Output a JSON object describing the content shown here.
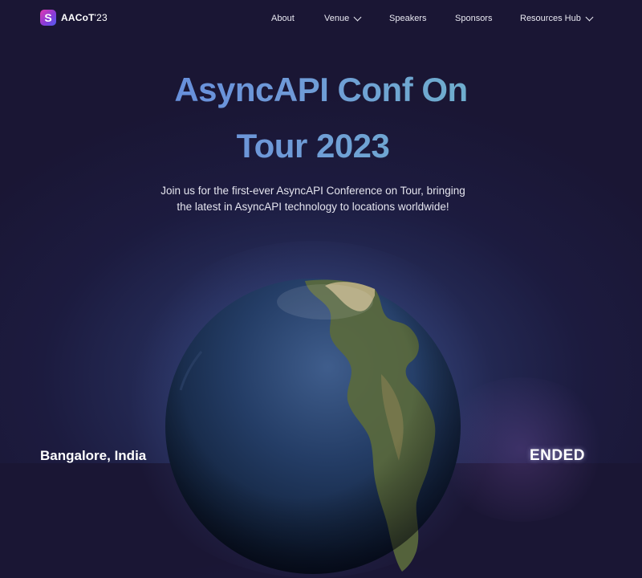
{
  "nav": {
    "logo_letter": "S",
    "logo_text": "AACoT",
    "logo_year": "'23",
    "items": [
      {
        "label": "About"
      },
      {
        "label": "Venue"
      },
      {
        "label": "Speakers"
      },
      {
        "label": "Sponsors"
      },
      {
        "label": "Resources Hub"
      }
    ]
  },
  "hero": {
    "title_line1": "AsyncAPI Conf On",
    "title_line2": "Tour 2023",
    "subtitle": "Join us for the first-ever AsyncAPI Conference on Tour, bringing the latest in AsyncAPI technology to locations worldwide!"
  },
  "event": {
    "location": "Bangalore, India",
    "status": "ENDED"
  },
  "colors": {
    "background": "#1c1b3f",
    "title_gradient_start": "#5b7fe0",
    "title_gradient_end": "#6fc0c4",
    "logo_gradient_start": "#e23ab0",
    "logo_gradient_end": "#4f5df0"
  },
  "icons": {
    "logo": "logo-icon",
    "venue_dropdown": "chevron-down-icon",
    "resources_dropdown": "chevron-down-icon"
  }
}
